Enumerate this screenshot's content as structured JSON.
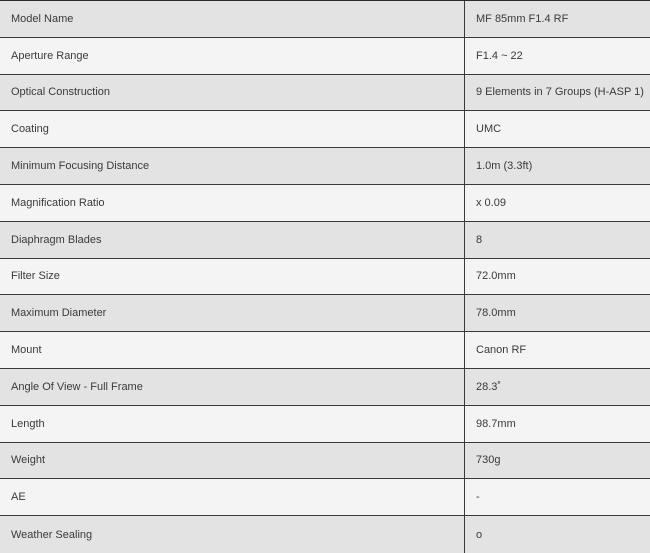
{
  "specs": [
    {
      "label": "Model Name",
      "value": "MF 85mm F1.4 RF"
    },
    {
      "label": "Aperture Range",
      "value": "F1.4 ~ 22"
    },
    {
      "label": "Optical Construction",
      "value": "9 Elements in 7 Groups (H-ASP 1)"
    },
    {
      "label": "Coating",
      "value": "UMC"
    },
    {
      "label": "Minimum Focusing Distance",
      "value": "1.0m (3.3ft)"
    },
    {
      "label": "Magnification Ratio",
      "value": "x 0.09"
    },
    {
      "label": "Diaphragm Blades",
      "value": "8"
    },
    {
      "label": "Filter Size",
      "value": "72.0mm"
    },
    {
      "label": "Maximum Diameter",
      "value": "78.0mm"
    },
    {
      "label": "Mount",
      "value": "Canon RF"
    },
    {
      "label": "Angle Of View - Full Frame",
      "value": "28.3˚"
    },
    {
      "label": "Length",
      "value": "98.7mm"
    },
    {
      "label": "Weight",
      "value": "730g"
    },
    {
      "label": "AE",
      "value": "-"
    },
    {
      "label": "Weather Sealing",
      "value": "o"
    }
  ]
}
